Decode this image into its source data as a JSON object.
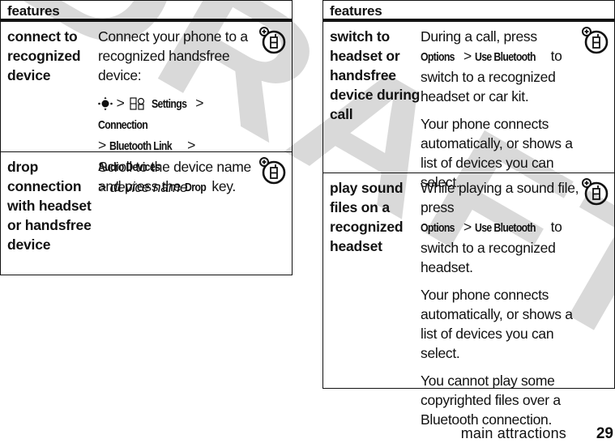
{
  "watermark": {
    "text": "DRAFT",
    "color": "#d9d9d9"
  },
  "left_table": {
    "header": "features",
    "rows": [
      {
        "feature": "connect to recognized device",
        "description": {
          "intro": "Connect your phone to a recognized handsfree device:",
          "path": {
            "separator": ">",
            "nav_key_icon": "nav-key-icon",
            "settings_icon": "settings-icon",
            "steps": [
              "Settings",
              "Connection",
              "Bluetooth Link",
              "Audio Devices"
            ],
            "final_step": "device name"
          }
        },
        "icon": "network-feature-icon"
      },
      {
        "feature": "drop connection with headset or handsfree device",
        "description": {
          "before": "Scroll to the device name and press the",
          "key": "Drop",
          "after": "key."
        },
        "icon": "network-feature-icon"
      }
    ]
  },
  "right_table": {
    "header": "features",
    "rows": [
      {
        "feature": "switch to headset or handsfree device during call",
        "description": {
          "before": "During a call, press",
          "menu": [
            "Options",
            "Use Bluetooth"
          ],
          "separator": ">",
          "after": "to switch to a recognized headset or car kit.",
          "note": "Your phone connects automatically, or shows a list of devices you can select."
        },
        "icon": "network-feature-icon"
      },
      {
        "feature": "play sound files on a recognized headset",
        "description": {
          "before": "While playing a sound file, press",
          "menu": [
            "Options",
            "Use Bluetooth"
          ],
          "separator": ">",
          "after": "to switch to a recognized headset.",
          "note": "Your phone connects automatically, or shows a list of devices you can select.",
          "note2": "You cannot play some copyrighted files over a Bluetooth connection."
        },
        "icon": "network-feature-icon"
      }
    ]
  },
  "footer": {
    "section": "main attractions",
    "page_number": "29"
  }
}
